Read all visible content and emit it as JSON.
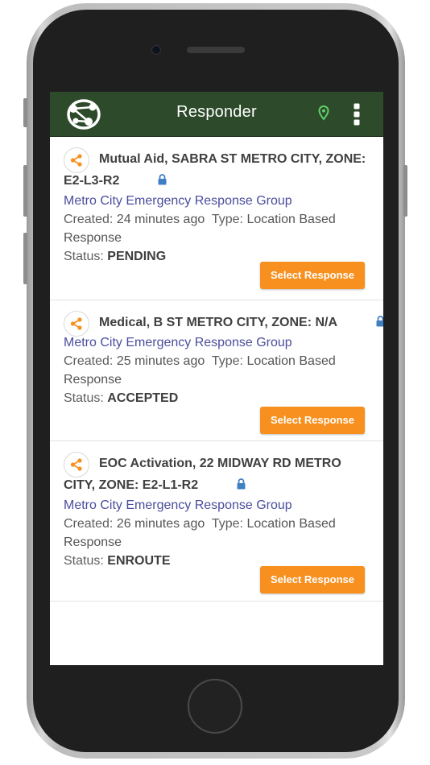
{
  "header": {
    "title": "Responder",
    "logo_icon": "globe-network-icon",
    "location_icon": "map-pin-icon",
    "menu_icon": "more-vertical-icon"
  },
  "colors": {
    "header_bg": "#2d4a2a",
    "accent_orange": "#f7901e",
    "group_link": "#4a4e9c",
    "lock_blue": "#3f7fc4",
    "pin_green": "#5fcf6a"
  },
  "responses": [
    {
      "title": "Mutual Aid, SABRA ST METRO CITY, ZONE: E2-L3-R2",
      "group": "Metro City Emergency Response Group",
      "created_label": "Created:",
      "created_value": "24 minutes ago",
      "type_label": "Type:",
      "type_value": "Location Based Response",
      "status_label": "Status:",
      "status_value": "PENDING",
      "button_label": "Select Response"
    },
    {
      "title": "Medical, B ST METRO CITY, ZONE: N/A",
      "group": "Metro City Emergency Response Group",
      "created_label": "Created:",
      "created_value": "25 minutes ago",
      "type_label": "Type:",
      "type_value": "Location Based Response",
      "status_label": "Status:",
      "status_value": "ACCEPTED",
      "button_label": "Select Response"
    },
    {
      "title": "EOC Activation, 22 MIDWAY RD METRO CITY, ZONE: E2-L1-R2",
      "group": "Metro City Emergency Response Group",
      "created_label": "Created:",
      "created_value": "26 minutes ago",
      "type_label": "Type:",
      "type_value": "Location Based Response",
      "status_label": "Status:",
      "status_value": "ENROUTE",
      "button_label": "Select Response"
    }
  ]
}
